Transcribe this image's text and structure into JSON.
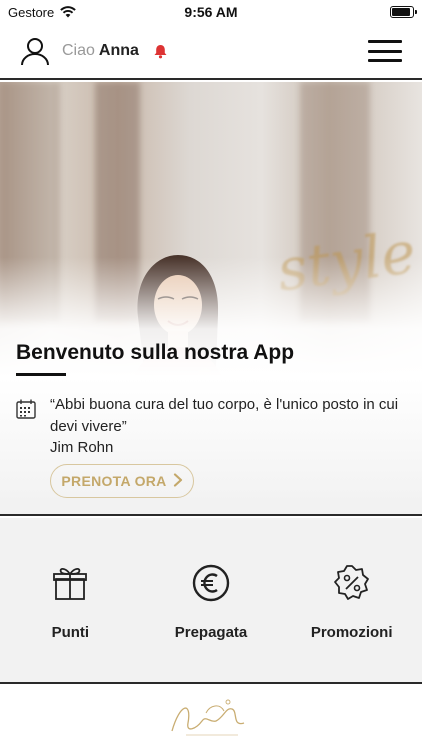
{
  "status_bar": {
    "carrier": "Gestore",
    "time": "9:56 AM",
    "battery_level": 0.9
  },
  "header": {
    "greeting_prefix": "Ciao",
    "user_name": "Anna",
    "icons": [
      "user-icon",
      "bell-icon",
      "menu-icon"
    ],
    "bell_color": "#dd3333"
  },
  "hero": {
    "title": "Benvenuto sulla nostra App"
  },
  "quote": {
    "text": "“Abbi buona cura del tuo corpo, è l'unico posto in cui devi vivere”",
    "author": "Jim Rohn",
    "button_label": "PRENOTA ORA",
    "accent_color": "#c4a86a"
  },
  "features": [
    {
      "label": "Punti",
      "icon": "gift-icon"
    },
    {
      "label": "Prepagata",
      "icon": "euro-icon"
    },
    {
      "label": "Promozioni",
      "icon": "percent-badge-icon"
    }
  ]
}
